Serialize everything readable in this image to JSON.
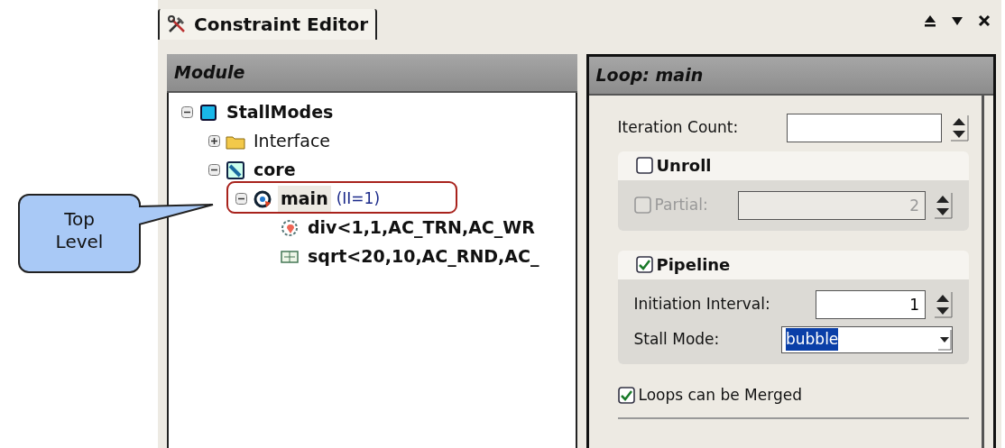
{
  "tab": {
    "title": "Constraint Editor",
    "selected": true
  },
  "module_panel": {
    "title": "Module",
    "tree": [
      {
        "label": "StallModes",
        "kind": "module",
        "bold": true,
        "expanded": true,
        "selected": false,
        "children": [
          {
            "label": "Interface",
            "kind": "folder",
            "bold": false,
            "expanded": false,
            "selected": false
          },
          {
            "label": "core",
            "kind": "core",
            "bold": true,
            "expanded": true,
            "selected": false,
            "children": [
              {
                "label": "main",
                "suffix": "(II=1)",
                "kind": "loop",
                "bold": true,
                "expanded": true,
                "selected": true,
                "children": [
                  {
                    "label": "div<1,1,AC_TRN,AC_WR",
                    "kind": "gear",
                    "bold": true,
                    "selected": false
                  },
                  {
                    "label": "sqrt<20,10,AC_RND,AC_",
                    "kind": "block",
                    "bold": true,
                    "selected": false
                  }
                ]
              }
            ]
          }
        ]
      }
    ]
  },
  "loop_panel": {
    "title": "Loop: main",
    "iteration_count": {
      "label": "Iteration Count:"
    },
    "unroll": {
      "label": "Unroll",
      "checked": false,
      "partial": {
        "label": "Partial:",
        "checked": false,
        "disabled": true,
        "value": "2"
      }
    },
    "pipeline": {
      "label": "Pipeline",
      "checked": true,
      "initiation_interval": {
        "label": "Initiation Interval:",
        "value": "1"
      },
      "stall_mode": {
        "label": "Stall Mode:",
        "value": "bubble"
      }
    },
    "merge": {
      "label": "Loops can be Merged",
      "checked": true
    }
  },
  "callout": {
    "text": "Top Level"
  }
}
